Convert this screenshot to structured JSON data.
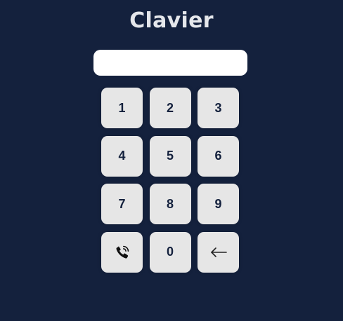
{
  "app": {
    "title": "Clavier"
  },
  "display": {
    "value": "",
    "placeholder": ""
  },
  "keypad": {
    "keys": [
      {
        "label": "1"
      },
      {
        "label": "2"
      },
      {
        "label": "3"
      },
      {
        "label": "4"
      },
      {
        "label": "5"
      },
      {
        "label": "6"
      },
      {
        "label": "7"
      },
      {
        "label": "8"
      },
      {
        "label": "9"
      },
      {
        "icon": "phone-call-icon"
      },
      {
        "label": "0"
      },
      {
        "icon": "backspace-arrow-icon"
      }
    ]
  },
  "colors": {
    "background": "#14213d",
    "key_background": "#e6e6e6",
    "key_text": "#14213d",
    "title_text": "#e5e7eb",
    "display_background": "#ffffff"
  }
}
